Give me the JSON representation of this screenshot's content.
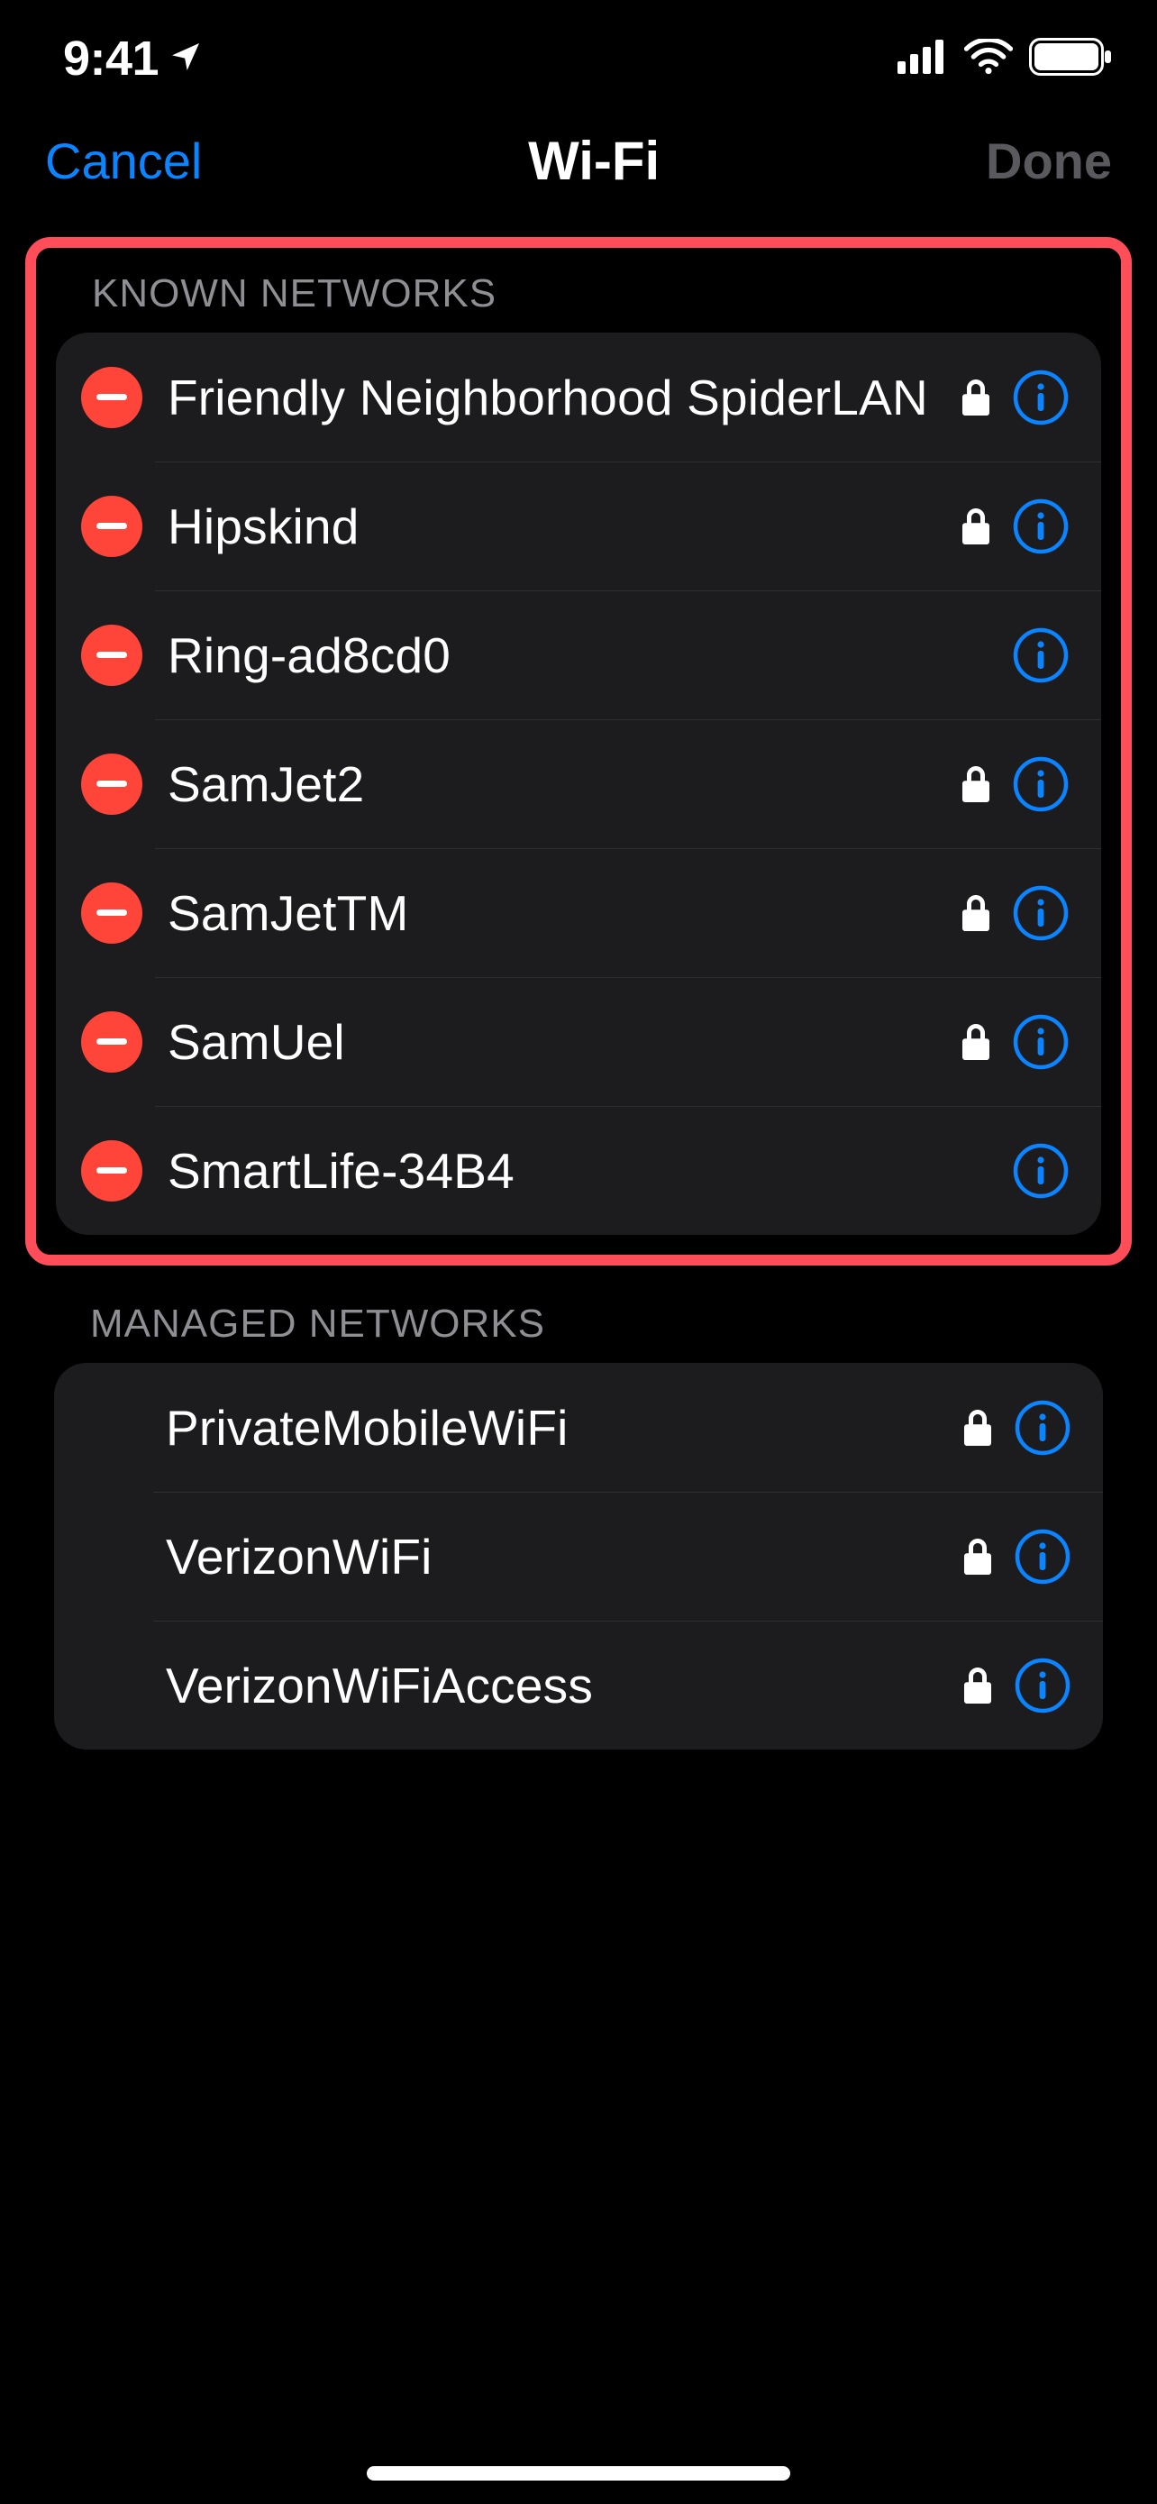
{
  "status": {
    "time": "9:41"
  },
  "nav": {
    "cancel": "Cancel",
    "title": "Wi-Fi",
    "done": "Done"
  },
  "sections": {
    "known": {
      "header": "KNOWN NETWORKS",
      "items": [
        {
          "name": "Friendly Neighborhood SpiderLAN",
          "locked": true
        },
        {
          "name": "Hipskind",
          "locked": true
        },
        {
          "name": "Ring-ad8cd0",
          "locked": false
        },
        {
          "name": "SamJet2",
          "locked": true
        },
        {
          "name": "SamJetTM",
          "locked": true
        },
        {
          "name": "SamUel",
          "locked": true
        },
        {
          "name": "SmartLife-34B4",
          "locked": false
        }
      ]
    },
    "managed": {
      "header": "MANAGED NETWORKS",
      "items": [
        {
          "name": "PrivateMobileWiFi",
          "locked": true
        },
        {
          "name": "VerizonWiFi",
          "locked": true
        },
        {
          "name": "VerizonWiFiAccess",
          "locked": true
        }
      ]
    }
  },
  "colors": {
    "accent": "#0a84ff",
    "destructive": "#ff453a",
    "highlight": "#ff4d5a"
  }
}
